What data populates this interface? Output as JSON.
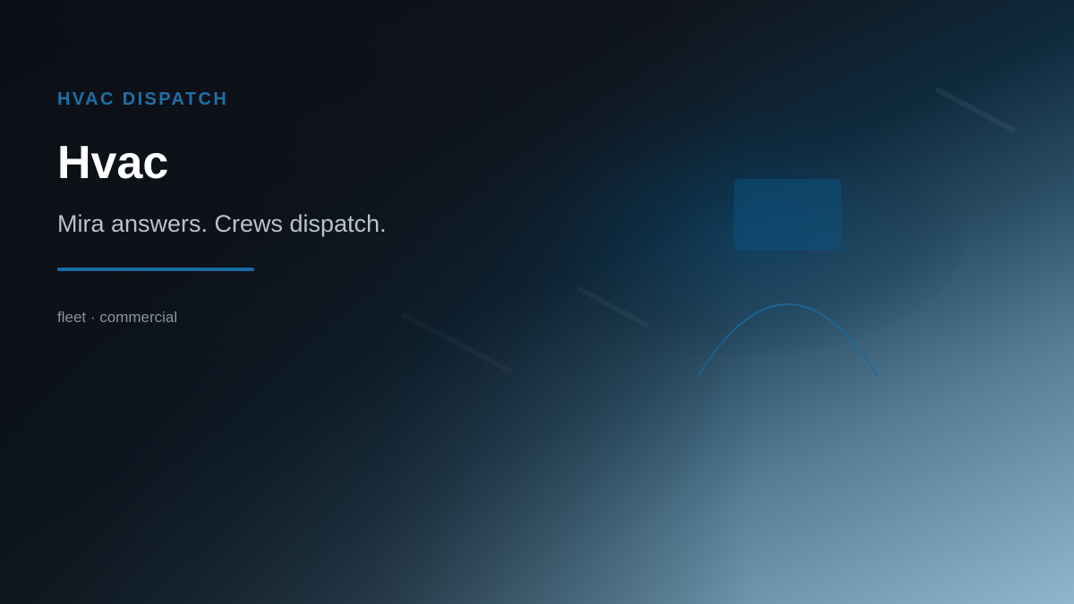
{
  "hero": {
    "eyebrow": "HVAC DISPATCH",
    "title": "Hvac",
    "tagline": "Mira answers. Crews dispatch.",
    "meta": "fleet · commercial"
  },
  "colors": {
    "accent": "#1f6fa8",
    "title": "#ffffff",
    "tagline": "#b9c1ca",
    "meta": "#8a939d",
    "background_dark": "#0f141b",
    "background_light": "#8fb6cc"
  }
}
